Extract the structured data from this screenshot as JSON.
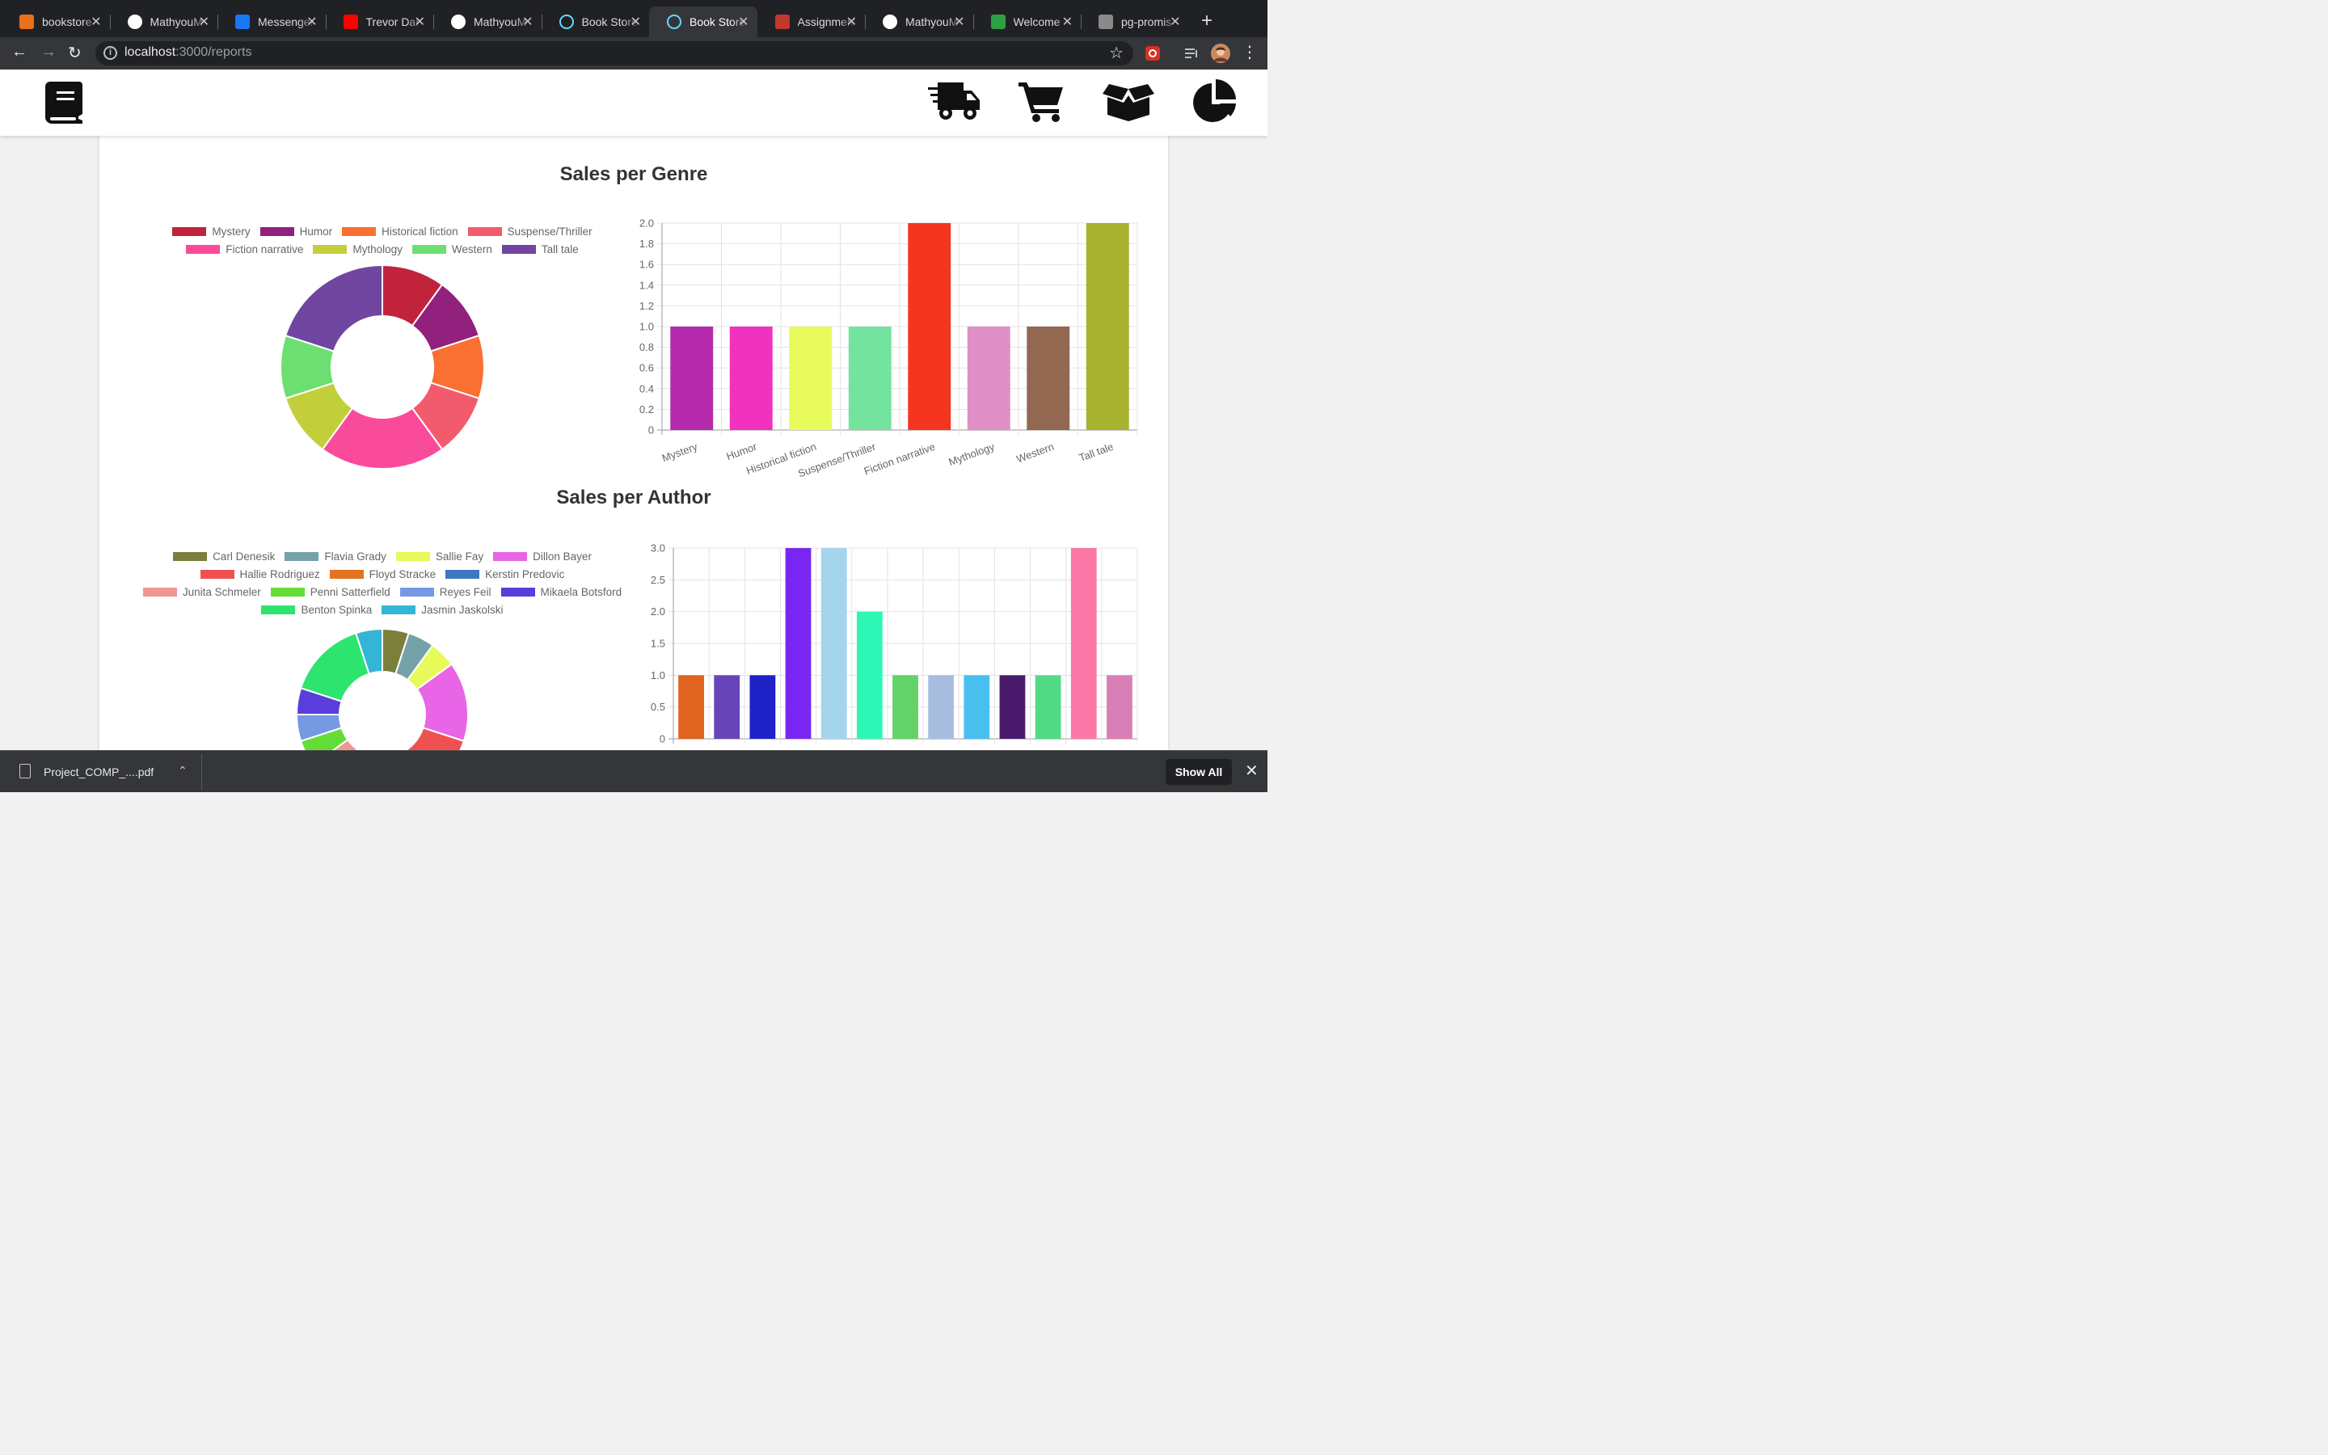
{
  "browser": {
    "tabs": [
      {
        "title": "bookstore",
        "icon": "orange-app-icon",
        "color": "#e8711a",
        "active": false
      },
      {
        "title": "MathyouM",
        "icon": "github-icon",
        "color": "#ffffff",
        "active": false
      },
      {
        "title": "Messenger",
        "icon": "facebook-icon",
        "color": "#1877f2",
        "active": false
      },
      {
        "title": "Trevor Dar",
        "icon": "youtube-icon",
        "color": "#ff0000",
        "active": false
      },
      {
        "title": "MathyouM",
        "icon": "github-icon",
        "color": "#ffffff",
        "active": false
      },
      {
        "title": "Book Store",
        "icon": "react-icon",
        "color": "#61dafb",
        "active": false
      },
      {
        "title": "Book Store",
        "icon": "react-icon",
        "color": "#61dafb",
        "active": true
      },
      {
        "title": "Assignment",
        "icon": "document-icon",
        "color": "#c0392b",
        "active": false
      },
      {
        "title": "MathyouM",
        "icon": "github-icon",
        "color": "#ffffff",
        "active": false
      },
      {
        "title": "Welcome",
        "icon": "postgres-elephant-icon",
        "color": "#2ea043",
        "active": false
      },
      {
        "title": "pg-promis",
        "icon": "globe-icon",
        "color": "#8a8a8a",
        "active": false
      }
    ],
    "url_host": "localhost",
    "url_rest": ":3000/reports"
  },
  "header": {
    "logo": "book-icon",
    "nav": [
      "delivery-truck-icon",
      "shopping-cart-icon",
      "open-box-icon",
      "pie-chart-icon"
    ]
  },
  "genre_section": {
    "title": "Sales per Genre"
  },
  "author_section": {
    "title": "Sales per Author"
  },
  "downloads": {
    "file": "Project_COMP_....pdf",
    "show_all": "Show All"
  },
  "chart_data": [
    {
      "type": "pie",
      "variant": "doughnut",
      "categories": [
        "Mystery",
        "Humor",
        "Historical fiction",
        "Suspense/Thriller",
        "Fiction narrative",
        "Mythology",
        "Western",
        "Tall tale"
      ],
      "values": [
        1,
        1,
        1,
        1,
        2,
        1,
        1,
        2
      ],
      "colors": [
        "#c0233b",
        "#91217d",
        "#fa6f32",
        "#f25b6e",
        "#fa4b9b",
        "#c3cf3a",
        "#6ddf70",
        "#7046a0"
      ],
      "legend": "top"
    },
    {
      "type": "bar",
      "categories": [
        "Mystery",
        "Humor",
        "Historical fiction",
        "Suspense/Thriller",
        "Fiction narrative",
        "Mythology",
        "Western",
        "Tall tale"
      ],
      "values": [
        1,
        1,
        1,
        1,
        2,
        1,
        1,
        2
      ],
      "colors": [
        "#b52aad",
        "#f032be",
        "#e8fb5c",
        "#74e39e",
        "#f5361f",
        "#df8fc5",
        "#926851",
        "#a7b22e"
      ],
      "ylim": [
        0,
        2
      ],
      "yticks": [
        "0",
        "0.2",
        "0.4",
        "0.6",
        "0.8",
        "1.0",
        "1.2",
        "1.4",
        "1.6",
        "1.8",
        "2.0"
      ],
      "grid": true
    },
    {
      "type": "pie",
      "variant": "doughnut",
      "categories": [
        "Carl Denesik",
        "Flavia Grady",
        "Sallie Fay",
        "Dillon Bayer",
        "Hallie Rodriguez",
        "Floyd Stracke",
        "Kerstin Predovic",
        "Junita Schmeler",
        "Penni Satterfield",
        "Reyes Feil",
        "Mikaela Botsford",
        "Benton Spinka",
        "Jasmin Jaskolski"
      ],
      "values": [
        1,
        1,
        1,
        3,
        3,
        2,
        1,
        1,
        1,
        1,
        1,
        3,
        1
      ],
      "colors": [
        "#7a7f3b",
        "#75a1a9",
        "#e7fa5a",
        "#e765e6",
        "#f05150",
        "#e37321",
        "#3f77c2",
        "#ec988f",
        "#65dd38",
        "#7599e2",
        "#5a3edc",
        "#2de46f",
        "#35b5d6"
      ],
      "legend": "top"
    },
    {
      "type": "bar",
      "categories": [
        "",
        "",
        "",
        "",
        "",
        "",
        "",
        "",
        "",
        "",
        "",
        "",
        ""
      ],
      "values": [
        1,
        1,
        1,
        3,
        3,
        2,
        1,
        1,
        1,
        1,
        1,
        3,
        1
      ],
      "colors": [
        "#e0631f",
        "#6645b9",
        "#1f22c7",
        "#7826f1",
        "#a4d5ec",
        "#2ef7b5",
        "#63d26a",
        "#a8bee1",
        "#48bfef",
        "#4a1b6c",
        "#52db87",
        "#fb77a6",
        "#d97fb6"
      ],
      "ylim": [
        0,
        3
      ],
      "yticks": [
        "0",
        "0.5",
        "1.0",
        "1.5",
        "2.0",
        "2.5",
        "3.0"
      ],
      "grid": true
    }
  ]
}
